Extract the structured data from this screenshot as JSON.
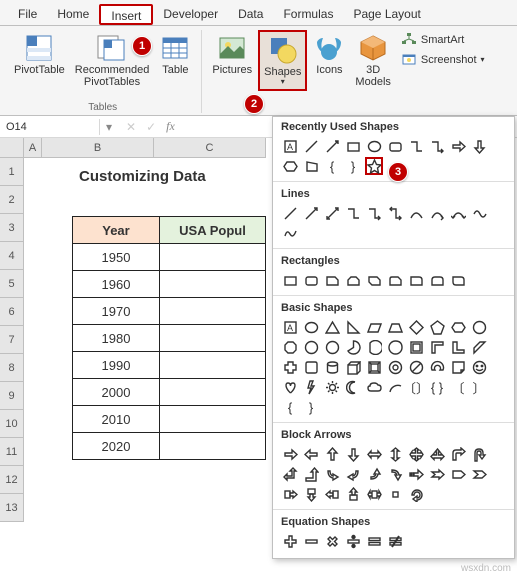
{
  "ribbon": {
    "tabs": [
      "File",
      "Home",
      "Insert",
      "Developer",
      "Data",
      "Formulas",
      "Page Layout"
    ],
    "active_tab": "Insert",
    "groups": {
      "tables": {
        "label": "Tables",
        "pivottable": "PivotTable",
        "recommended": "Recommended\nPivotTables",
        "table": "Table"
      },
      "illustrations": {
        "pictures": "Pictures",
        "shapes": "Shapes",
        "icons": "Icons",
        "models3d": "3D\nModels",
        "smartart": "SmartArt",
        "screenshot": "Screenshot"
      }
    }
  },
  "step_badges": {
    "s1": "1",
    "s2": "2",
    "s3": "3"
  },
  "namebox": {
    "value": "O14"
  },
  "fx": {
    "label": "fx"
  },
  "columns": [
    "A",
    "B",
    "C"
  ],
  "rows": [
    "1",
    "2",
    "3",
    "4",
    "5",
    "6",
    "7",
    "8",
    "9",
    "10",
    "11",
    "12",
    "13"
  ],
  "sheet": {
    "title": "Customizing Data",
    "headers": {
      "year": "Year",
      "pop": "USA Popul"
    },
    "years": [
      "1950",
      "1960",
      "1970",
      "1980",
      "1990",
      "2000",
      "2010",
      "2020"
    ]
  },
  "shapes_panel": {
    "recently": "Recently Used Shapes",
    "lines": "Lines",
    "rectangles": "Rectangles",
    "basic": "Basic Shapes",
    "block_arrows": "Block Arrows",
    "equation": "Equation Shapes"
  },
  "watermark": "wsxdn.com"
}
